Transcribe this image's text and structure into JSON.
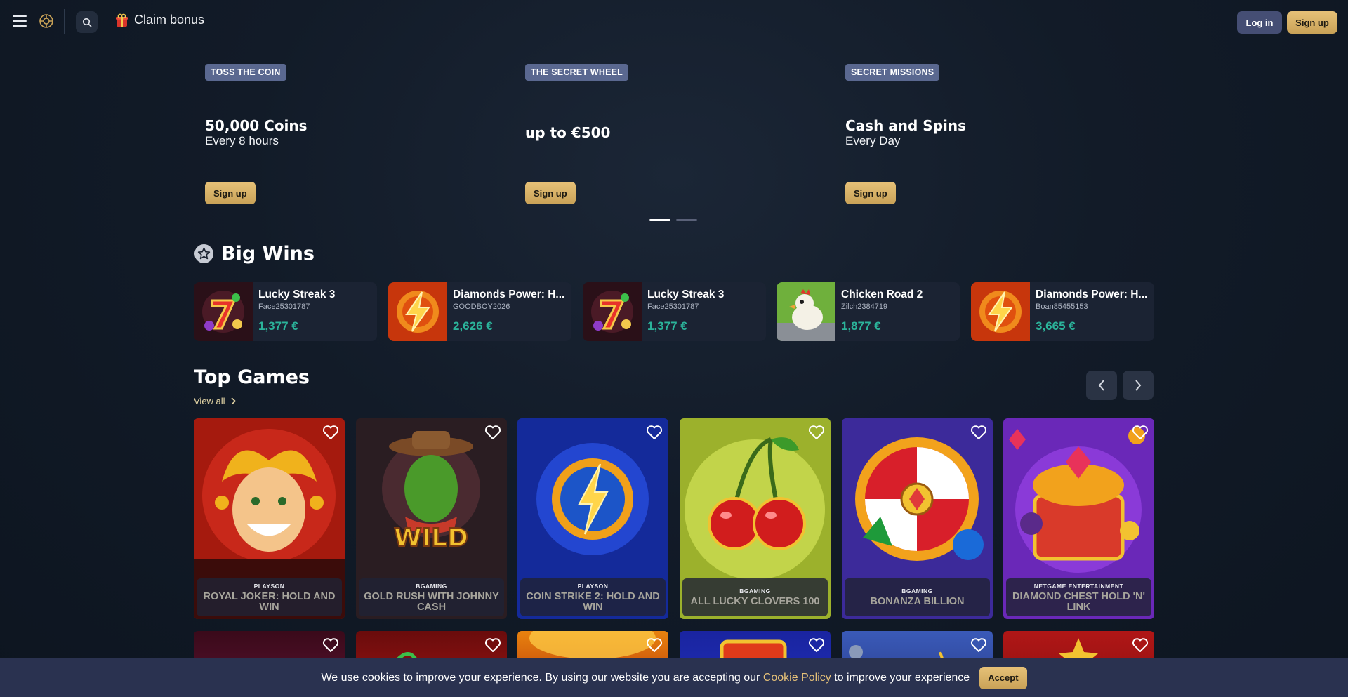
{
  "header": {
    "menu_icon": "hamburger-menu-icon",
    "logo_icon": "casino-logo-icon",
    "search_icon": "search-icon",
    "claim_icon": "gift-icon",
    "claim_label": "Claim bonus",
    "login_label": "Log in",
    "signup_label": "Sign up"
  },
  "promos": [
    {
      "tag": "TOSS THE COIN",
      "title": "50,000 Coins",
      "subtitle": "Every 8 hours",
      "button": "Sign up"
    },
    {
      "tag": "THE SECRET WHEEL",
      "title": "up to €500",
      "subtitle": "",
      "button": "Sign up"
    },
    {
      "tag": "SECRET MISSIONS",
      "title": "Cash and Spins",
      "subtitle": "Every Day",
      "button": "Sign up"
    }
  ],
  "carousel": {
    "pages": 2,
    "active": 0
  },
  "big_wins": {
    "icon": "star-icon",
    "title": "Big Wins",
    "items": [
      {
        "game": "Lucky Streak 3",
        "user": "Face25301787",
        "amount": "1,377 €",
        "thumb": "slot-seven-icon"
      },
      {
        "game": "Diamonds Power: H...",
        "user": "GOODBOY2026",
        "amount": "2,626 €",
        "thumb": "lightning-icon"
      },
      {
        "game": "Lucky Streak 3",
        "user": "Face25301787",
        "amount": "1,377 €",
        "thumb": "slot-seven-icon"
      },
      {
        "game": "Chicken Road 2",
        "user": "Zilch2384719",
        "amount": "1,877 €",
        "thumb": "chicken-icon"
      },
      {
        "game": "Diamonds Power: H...",
        "user": "Boan85455153",
        "amount": "3,665 €",
        "thumb": "lightning-icon"
      }
    ]
  },
  "top_games": {
    "title": "Top Games",
    "view_all": "View all",
    "prev_icon": "chevron-left-icon",
    "next_icon": "chevron-right-icon",
    "favorite_icon": "heart-icon",
    "games": [
      {
        "provider": "PLAYSON",
        "name": "ROYAL JOKER: HOLD AND WIN",
        "color": "#b3200f"
      },
      {
        "provider": "BGAMING",
        "name": "GOLD RUSH WITH JOHNNY CASH",
        "color": "#2a1d22"
      },
      {
        "provider": "PLAYSON",
        "name": "COIN STRIKE 2: HOLD AND WIN",
        "color": "#1b3fbf"
      },
      {
        "provider": "BGAMING",
        "name": "ALL LUCKY CLOVERS 100",
        "color": "#8fa52a"
      },
      {
        "provider": "BGAMING",
        "name": "BONANZA BILLION",
        "color": "#4b2eaa"
      },
      {
        "provider": "NETGAME ENTERTAINMENT",
        "name": "DIAMOND CHEST HOLD 'N' LINK",
        "color": "#7a2fc2"
      }
    ],
    "row2_colors": [
      "#5a1230",
      "#9a1414",
      "#d4560e",
      "#1e2fb5",
      "#2b3f8f",
      "#8e1212"
    ]
  },
  "cookie": {
    "text_before": "We use cookies to improve your experience. By using our website you are accepting our",
    "link": "Cookie Policy",
    "text_after": "to improve your experience",
    "accept": "Accept"
  }
}
